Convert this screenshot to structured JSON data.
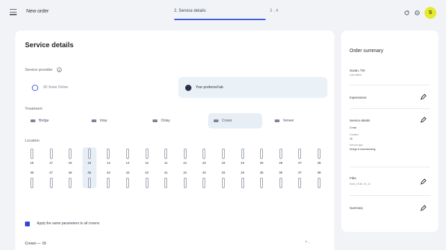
{
  "topbar": {
    "title": "New order",
    "step_current": "2. Service details",
    "step_sep": "·",
    "step_next": "3 · 4",
    "avatar_initial": "S"
  },
  "main": {
    "title": "Service details",
    "service_provider_label": "Service provider",
    "option_a": "3D Smile Online",
    "option_b": "Your preferred lab",
    "treatment_label": "Treatment",
    "treatments": [
      "Bridge",
      "Inlay",
      "Onlay",
      "Crown",
      "Veneer"
    ],
    "location_label": "Location",
    "upper_numbers": [
      "18",
      "17",
      "16",
      "15",
      "14",
      "13",
      "12",
      "11",
      "21",
      "22",
      "23",
      "24",
      "25",
      "26",
      "27",
      "28"
    ],
    "lower_numbers": [
      "48",
      "47",
      "46",
      "45",
      "44",
      "43",
      "42",
      "41",
      "31",
      "32",
      "33",
      "34",
      "35",
      "36",
      "37",
      "38"
    ],
    "checkbox_label": "Apply the same parameters to all crowns",
    "bottom_section": "Crown — 15",
    "bottom_controls": "^  ·"
  },
  "summary": {
    "title": "Order summary",
    "patient_name": "Susan, Tim",
    "patient_sub": "Last edited",
    "item_impressions": "Impressions",
    "item_service": "Service details",
    "svc_line1": "Crown",
    "svc_line2": "Location",
    "svc_line3": "15",
    "svc_line4": "Service type",
    "svc_line5": "Design & manufacturing",
    "files_label": "Files",
    "files_sub": "Scan_15.stl, 16_12",
    "summary_label": "Summary"
  },
  "colors": {
    "accent": "#3b5bd6",
    "avatar": "#e5ea2c",
    "selected_bg": "#e8eef5"
  }
}
